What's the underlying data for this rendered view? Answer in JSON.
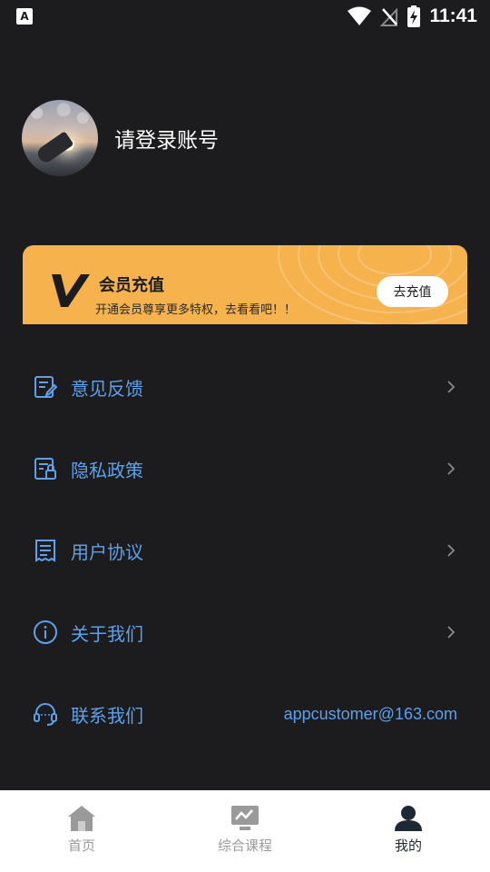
{
  "status_bar": {
    "sim_label": "A",
    "time": "11:41"
  },
  "profile": {
    "login_text": "请登录账号"
  },
  "vip": {
    "title": "会员充值",
    "subtitle": "开通会员尊享更多特权，去看看吧！！",
    "button": "去充值",
    "color": "#f6b24d"
  },
  "menu": {
    "items": [
      {
        "label": "意见反馈",
        "icon": "feedback-icon"
      },
      {
        "label": "隐私政策",
        "icon": "privacy-icon"
      },
      {
        "label": "用户协议",
        "icon": "agreement-icon"
      },
      {
        "label": "关于我们",
        "icon": "info-icon"
      },
      {
        "label": "联系我们",
        "icon": "headset-icon",
        "value": "appcustomer@163.com"
      }
    ],
    "accent": "#5ea0ea"
  },
  "bottom_nav": {
    "items": [
      {
        "label": "首页",
        "icon": "home-icon"
      },
      {
        "label": "综合课程",
        "icon": "course-icon"
      },
      {
        "label": "我的",
        "icon": "profile-icon",
        "active": true
      }
    ]
  }
}
